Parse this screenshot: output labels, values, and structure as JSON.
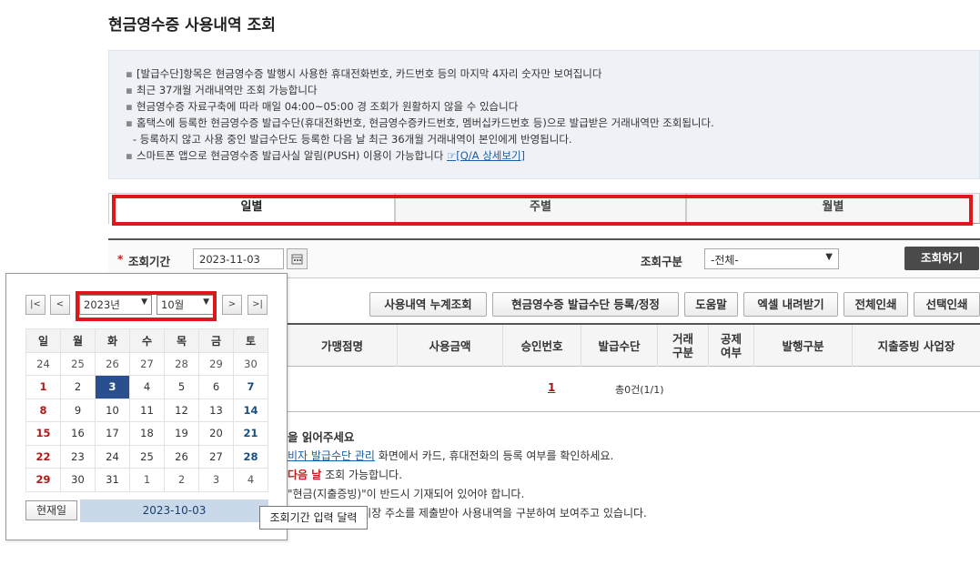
{
  "page_title": "현금영수증 사용내역 조회",
  "notice": {
    "lines": [
      "[발급수단]항목은 현금영수증 발행시 사용한 휴대전화번호, 카드번호 등의 마지막 4자리 숫자만 보여집니다",
      "최근 37개월 거래내역만 조회 가능합니다",
      "현금영수증 자료구축에 따라 매일 04:00~05:00 경 조회가 원활하지 않을 수 있습니다",
      "홈택스에 등록한 현금영수증 발급수단(휴대전화번호, 현금영수증카드번호, 멤버십카드번호 등)으로 발급받은 거래내역만 조회됩니다.",
      "- 등록하지 않고 사용 중인 발급수단도 등록한 다음 날 최근 36개월 거래내역이 본인에게 반영됩니다.",
      "스마트폰 앱으로 현금영수증 발급사실 알림(PUSH) 이용이 가능합니다"
    ],
    "qa_link": "☞[Q/A 상세보기]"
  },
  "tabs": [
    "일별",
    "주별",
    "월별"
  ],
  "search": {
    "period_label": "조회기간",
    "date_value": "2023-11-03",
    "kind_label": "조회구분",
    "kind_selected": "-전체-",
    "submit": "조회하기"
  },
  "buttons": [
    "사용내역 누계조회",
    "현금영수증 발급수단 등록/정정",
    "도움말",
    "엑셀 내려받기",
    "전체인쇄",
    "선택인쇄"
  ],
  "table": {
    "headers": [
      "가맹점명",
      "사용금액",
      "승인번호",
      "발급수단",
      "거래\n구분",
      "공제\n여부",
      "발행구분",
      "지출증빙 사업장"
    ],
    "page": "1",
    "total": "총0건(1/1)"
  },
  "guide": {
    "title_suffix": "을 읽어주세요",
    "l1_link": "비자 발급수단 관리",
    "l1_text": " 화면에서 카드, 휴대전화의 등록 여부를 확인하세요.",
    "l2_red": "다음 날",
    "l2_text": " 조회 가능합니다.",
    "l3_text": "\"현금(지출증빙)\"이 반드시 기재되어 있어야 합니다.",
    "l4_text": "단체로부터 전통시장 주소를 제출받아 사용내역을 구분하여 보여주고 있습니다."
  },
  "calendar": {
    "year": "2023년",
    "month": "10월",
    "weekdays": [
      "일",
      "월",
      "화",
      "수",
      "목",
      "금",
      "토"
    ],
    "weeks": [
      [
        "24",
        "25",
        "26",
        "27",
        "28",
        "29",
        "30"
      ],
      [
        "1",
        "2",
        "3",
        "4",
        "5",
        "6",
        "7"
      ],
      [
        "8",
        "9",
        "10",
        "11",
        "12",
        "13",
        "14"
      ],
      [
        "15",
        "16",
        "17",
        "18",
        "19",
        "20",
        "21"
      ],
      [
        "22",
        "23",
        "24",
        "25",
        "26",
        "27",
        "28"
      ],
      [
        "29",
        "30",
        "31",
        "1",
        "2",
        "3",
        "4"
      ]
    ],
    "selected": "3",
    "today_label": "현재일",
    "today_date": "2023-10-03"
  },
  "tooltip": "조회기간 입력 달력",
  "icons": {
    "calendar": "calendar-icon",
    "first": "|<",
    "prev": "<",
    "next": ">",
    "last": ">|"
  },
  "colors": {
    "highlight": "#e0161d",
    "selected_day": "#2a4f8f",
    "search_button": "#4a4a4a"
  }
}
